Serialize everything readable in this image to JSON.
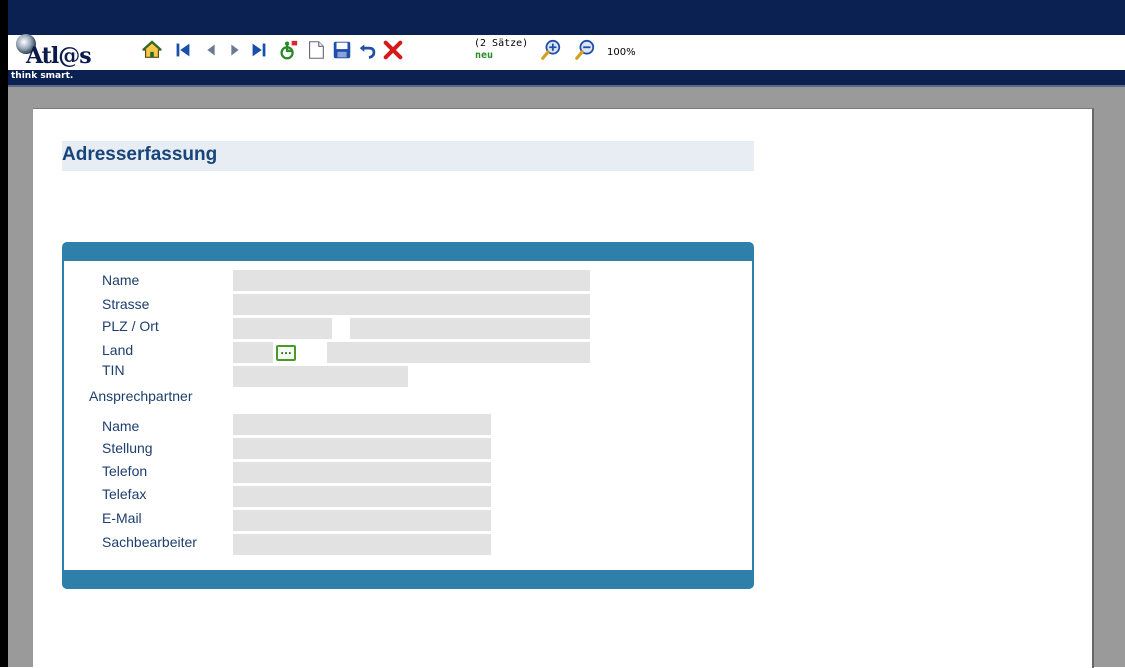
{
  "app": {
    "logo_text": "Atl@s",
    "tagline": "think smart."
  },
  "toolbar": {
    "record_count": "(2 Sätze)",
    "record_status": "neu",
    "zoom_level": "100%",
    "icons": [
      "home-icon",
      "first-record-icon",
      "previous-record-icon",
      "next-record-icon",
      "last-record-icon",
      "help-accessibility-icon",
      "new-document-icon",
      "save-icon",
      "undo-icon",
      "delete-icon",
      "zoom-in-icon",
      "zoom-out-icon"
    ]
  },
  "page": {
    "title": "Adresserfassung"
  },
  "form": {
    "name_label": "Name",
    "street_label": "Strasse",
    "zip_city_label": "PLZ / Ort",
    "country_label": "Land",
    "country_lookup_label": "...",
    "tin_label": "TIN",
    "contact_section_label": "Ansprechpartner",
    "contact_name_label": "Name",
    "position_label": "Stellung",
    "phone_label": "Telefon",
    "fax_label": "Telefax",
    "email_label": "E-Mail",
    "clerk_label": "Sachbearbeiter"
  },
  "colors": {
    "header_navy": "#0a2152",
    "panel_blue": "#2e7fa9",
    "title_blue": "#17457a",
    "label_blue": "#1c3f6e",
    "field_gray": "#e2e2e2",
    "status_green": "#2a8a2a"
  }
}
